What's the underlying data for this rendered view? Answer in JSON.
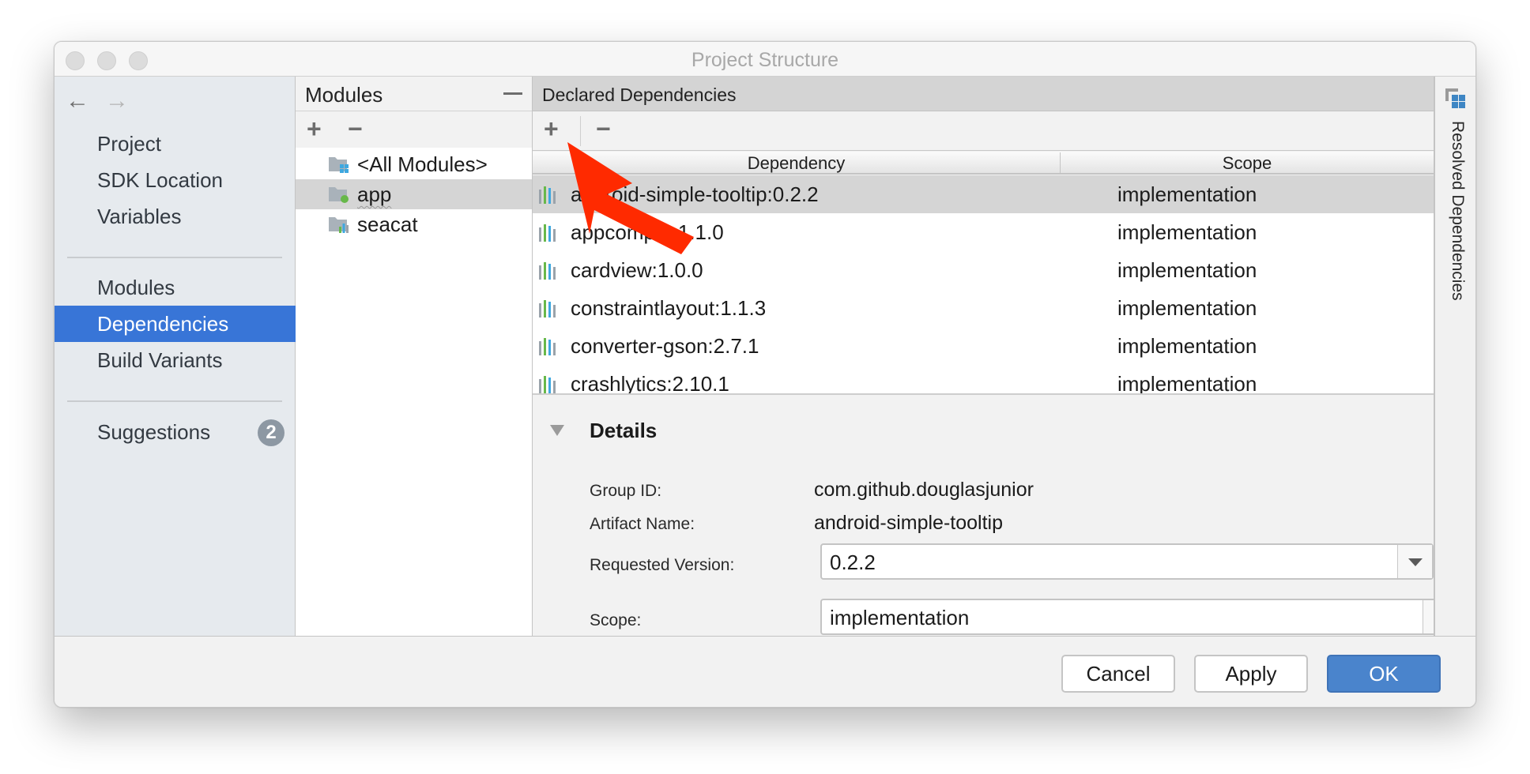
{
  "window": {
    "title": "Project Structure"
  },
  "sidebar": {
    "back_icon": "arrow-left-icon",
    "forward_icon": "arrow-right-icon",
    "groups": [
      [
        "Project",
        "SDK Location",
        "Variables"
      ],
      [
        "Modules",
        "Dependencies",
        "Build Variants"
      ],
      [
        "Suggestions"
      ]
    ],
    "items": [
      {
        "label": "Project"
      },
      {
        "label": "SDK Location"
      },
      {
        "label": "Variables"
      },
      {
        "label": "Modules"
      },
      {
        "label": "Dependencies",
        "selected": true
      },
      {
        "label": "Build Variants"
      },
      {
        "label": "Suggestions",
        "badge": "2"
      }
    ],
    "accent_color": "#3875d7"
  },
  "modules_panel": {
    "title": "Modules",
    "add_label": "+",
    "remove_label": "−",
    "items": [
      {
        "label": "<All Modules>",
        "icon": "all-modules-folder-icon"
      },
      {
        "label": "app",
        "icon": "app-module-folder-icon",
        "selected": true
      },
      {
        "label": "seacat",
        "icon": "library-module-folder-icon"
      }
    ]
  },
  "dependencies_panel": {
    "title": "Declared Dependencies",
    "add_label": "+",
    "remove_label": "−",
    "columns": [
      "Dependency",
      "Scope"
    ],
    "rows": [
      {
        "dependency": "android-simple-tooltip:0.2.2",
        "scope": "implementation",
        "selected": true
      },
      {
        "dependency": "appcompat:1.1.0",
        "scope": "implementation"
      },
      {
        "dependency": "cardview:1.0.0",
        "scope": "implementation"
      },
      {
        "dependency": "constraintlayout:1.1.3",
        "scope": "implementation"
      },
      {
        "dependency": "converter-gson:2.7.1",
        "scope": "implementation"
      },
      {
        "dependency": "crashlytics:2.10.1",
        "scope": "implementation"
      }
    ]
  },
  "details": {
    "title": "Details",
    "group_id_label": "Group ID:",
    "group_id": "com.github.douglasjunior",
    "artifact_label": "Artifact Name:",
    "artifact": "android-simple-tooltip",
    "version_label": "Requested Version:",
    "version": "0.2.2",
    "scope_label": "Scope:",
    "scope": "implementation"
  },
  "right_strip": {
    "label": "Resolved Dependencies"
  },
  "footer": {
    "cancel": "Cancel",
    "apply": "Apply",
    "ok": "OK",
    "ok_color": "#4a84cc"
  },
  "annotation": {
    "color": "#ff2a00",
    "points_to": "add-dependency-button"
  }
}
